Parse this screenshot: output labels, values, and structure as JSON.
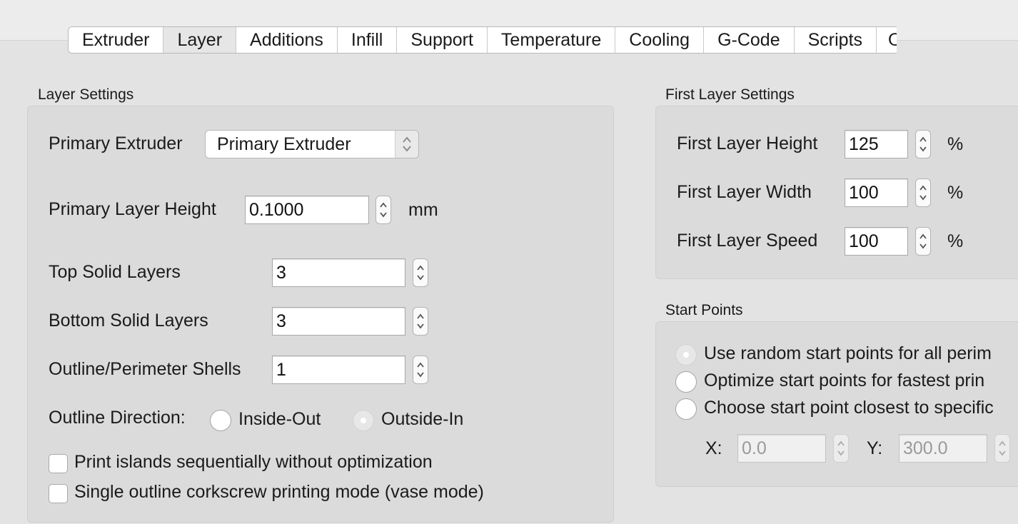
{
  "tabs": [
    {
      "label": "Extruder",
      "selected": false
    },
    {
      "label": "Layer",
      "selected": true
    },
    {
      "label": "Additions",
      "selected": false
    },
    {
      "label": "Infill",
      "selected": false
    },
    {
      "label": "Support",
      "selected": false
    },
    {
      "label": "Temperature",
      "selected": false
    },
    {
      "label": "Cooling",
      "selected": false
    },
    {
      "label": "G-Code",
      "selected": false
    },
    {
      "label": "Scripts",
      "selected": false
    },
    {
      "label": "O",
      "selected": false
    }
  ],
  "layer_settings": {
    "title": "Layer Settings",
    "primary_extruder": {
      "label": "Primary Extruder",
      "value": "Primary Extruder"
    },
    "primary_layer_height": {
      "label": "Primary Layer Height",
      "value": "0.1000",
      "unit": "mm"
    },
    "top_solid_layers": {
      "label": "Top Solid Layers",
      "value": "3"
    },
    "bottom_solid_layers": {
      "label": "Bottom Solid Layers",
      "value": "3"
    },
    "outline_shells": {
      "label": "Outline/Perimeter Shells",
      "value": "1"
    },
    "outline_direction": {
      "label": "Outline Direction:",
      "options": [
        {
          "label": "Inside-Out",
          "selected": false
        },
        {
          "label": "Outside-In",
          "selected": true
        }
      ]
    },
    "print_islands": {
      "label": "Print islands sequentially without optimization",
      "checked": false
    },
    "vase_mode": {
      "label": "Single outline corkscrew printing mode (vase mode)",
      "checked": false
    }
  },
  "first_layer": {
    "title": "First Layer Settings",
    "height": {
      "label": "First Layer Height",
      "value": "125",
      "unit": "%"
    },
    "width": {
      "label": "First Layer Width",
      "value": "100",
      "unit": "%"
    },
    "speed": {
      "label": "First Layer Speed",
      "value": "100",
      "unit": "%"
    }
  },
  "start_points": {
    "title": "Start Points",
    "options": [
      {
        "label": "Use random start points for all perim",
        "selected": true
      },
      {
        "label": "Optimize start points for fastest prin",
        "selected": false
      },
      {
        "label": "Choose start point closest to specific",
        "selected": false
      }
    ],
    "x": {
      "label": "X:",
      "value": "0.0"
    },
    "y": {
      "label": "Y:",
      "value": "300.0"
    }
  }
}
